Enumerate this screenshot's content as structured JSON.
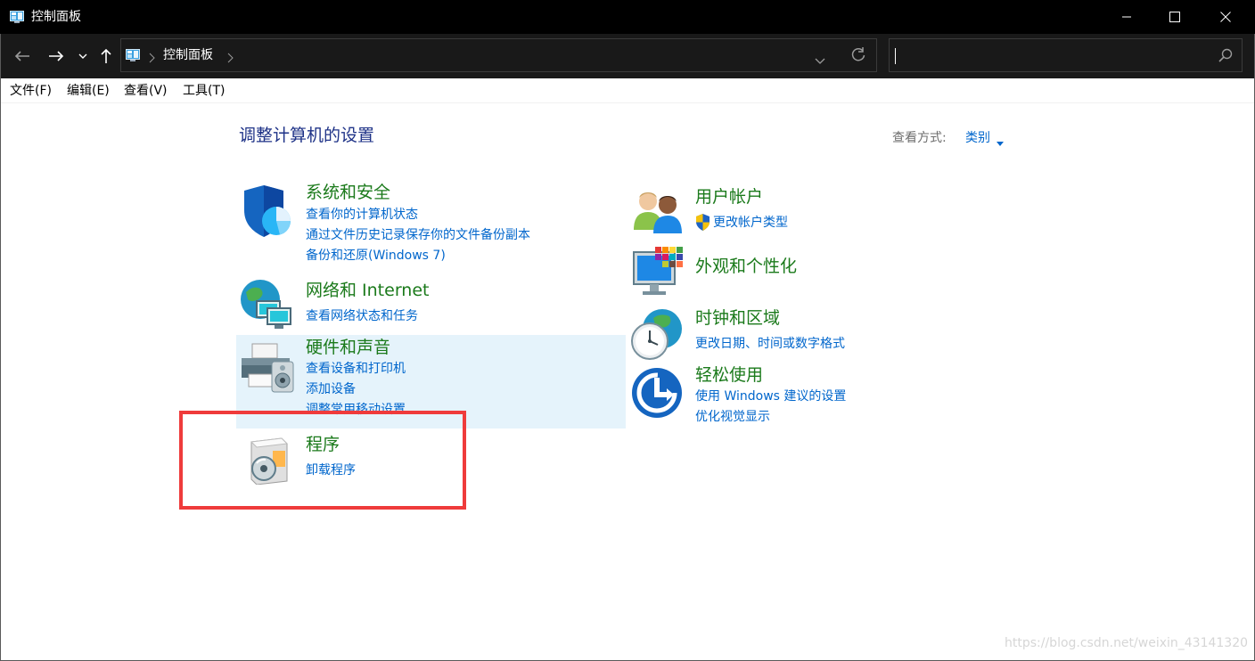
{
  "window": {
    "title": "控制面板",
    "app_icon": "control-panel-icon",
    "buttons": [
      "minimize-icon",
      "maximize-icon",
      "close-icon"
    ]
  },
  "address_bar": {
    "breadcrumb": "控制面板",
    "search_value": ""
  },
  "menu": {
    "file": "文件(F)",
    "edit": "编辑(E)",
    "view": "查看(V)",
    "tools": "工具(T)"
  },
  "page": {
    "heading": "调整计算机的设置",
    "view_by_label": "查看方式:",
    "view_by_value": "类别"
  },
  "categories": {
    "system_security": {
      "title": "系统和安全",
      "icon": "shield-icon",
      "links": [
        "查看你的计算机状态",
        "通过文件历史记录保存你的文件备份副本",
        "备份和还原(Windows 7)"
      ]
    },
    "network": {
      "title": "网络和 Internet",
      "icon": "network-globe-icon",
      "links": [
        "查看网络状态和任务"
      ]
    },
    "hardware": {
      "title": "硬件和声音",
      "icon": "printer-speaker-icon",
      "links": [
        "查看设备和打印机",
        "添加设备",
        "调整常用移动设置"
      ]
    },
    "programs": {
      "title": "程序",
      "icon": "programs-disc-icon",
      "links": [
        "卸载程序"
      ]
    },
    "user_accounts": {
      "title": "用户帐户",
      "icon": "users-icon",
      "links": [
        "更改帐户类型"
      ],
      "link_icon": "uac-shield-icon"
    },
    "appearance": {
      "title": "外观和个性化",
      "icon": "monitor-colors-icon",
      "links": []
    },
    "clock_region": {
      "title": "时钟和区域",
      "icon": "clock-globe-icon",
      "links": [
        "更改日期、时间或数字格式"
      ]
    },
    "ease_of_access": {
      "title": "轻松使用",
      "icon": "ease-of-access-icon",
      "links": [
        "使用 Windows 建议的设置",
        "优化视觉显示"
      ]
    }
  },
  "colors": {
    "category_title": "#1b7a1b",
    "link": "#0066cc",
    "heading": "#1e3287",
    "hover_bg": "#e5f3fb",
    "highlight_box": "#ef3b3b"
  },
  "watermark": "https://blog.csdn.net/weixin_43141320"
}
